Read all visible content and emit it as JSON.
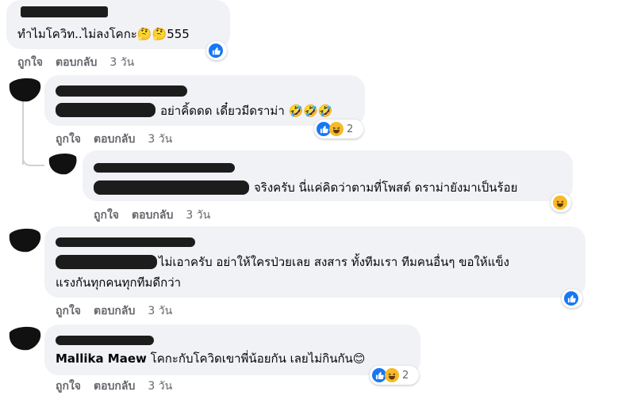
{
  "comments": [
    {
      "text": "ทำไมโควิท..ไม่ลงโคกะ🤔🤔555",
      "actions": {
        "like": "ถูกใจ",
        "reply": "ตอบกลับ",
        "time": "3 วัน"
      },
      "reaction": {
        "icons": [
          "like-icon"
        ]
      }
    },
    {
      "text": "อย่าคิ้ดดด เดี๋ยวมีดราม่า 🤣🤣🤣",
      "actions": {
        "like": "ถูกใจ",
        "reply": "ตอบกลับ",
        "time": "3 วัน"
      },
      "reaction": {
        "icons": [
          "like-icon",
          "haha-icon"
        ],
        "count": "2"
      }
    },
    {
      "text": "จริงครับ นี่แค่คิดว่าตามที่โพสต์ ดราม่ายังมาเป็นร้อย",
      "actions": {
        "like": "ถูกใจ",
        "reply": "ตอบกลับ",
        "time": "3 วัน"
      },
      "reaction": {
        "icons": [
          "haha-icon"
        ]
      }
    },
    {
      "text_line1": "ไม่เอาครับ อย่าให้ใครป่วยเลย สงสาร ทั้งทีมเรา ทีมคนอื่นๆ ขอให้แข็ง",
      "text_line2": "แรงกันทุกคนทุกทีมดีกว่า",
      "actions": {
        "like": "ถูกใจ",
        "reply": "ตอบกลับ",
        "time": "3 วัน"
      },
      "reaction": {
        "icons": [
          "like-icon"
        ]
      }
    },
    {
      "author": "Mallika Maew",
      "text": "โคกะกับโควิดเขาพี่น้อยกัน เลยไม่กินกัน😊",
      "actions": {
        "like": "ถูกใจ",
        "reply": "ตอบกลับ",
        "time": "3 วัน"
      },
      "reaction": {
        "icons": [
          "like-icon",
          "haha-icon"
        ],
        "count": "2"
      }
    }
  ],
  "colors": {
    "bubble": "#f0f2f5",
    "meta_text": "#65676b",
    "like_blue": "#1877f2",
    "haha_yellow": "#f7b928"
  }
}
